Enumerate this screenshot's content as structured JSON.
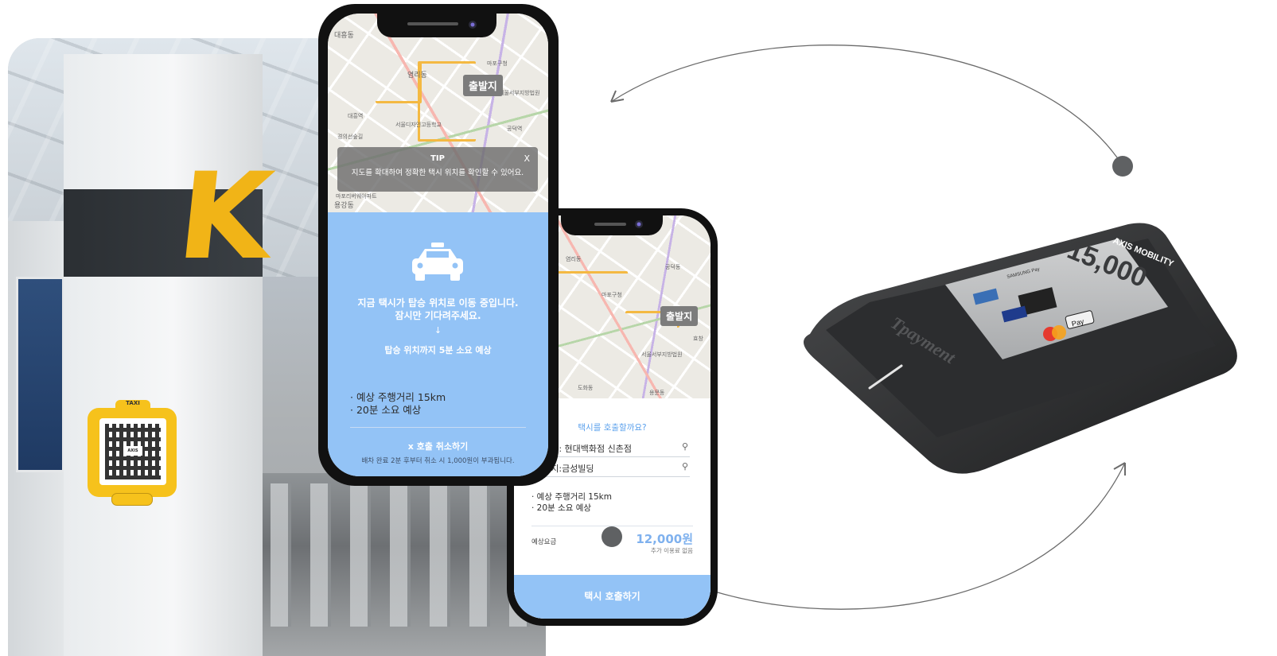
{
  "photo": {
    "pillar_letter": "K",
    "qr_sign_tab": "TAXI",
    "qr_sign_brand": "AXIS"
  },
  "phone_left": {
    "map": {
      "origin_badge": "출발지",
      "labels": [
        "대흥동",
        "염리동",
        "용강동",
        "마포구청",
        "서울서부지방법원",
        "대흥역",
        "경의선숲길",
        "서울디자인고등학교",
        "마포리버웨아파트",
        "공덕역"
      ]
    },
    "tip": {
      "title": "TIP",
      "text": "지도를 확대하여 정확한 택시 위치를 확인할 수 있어요.",
      "close": "X"
    },
    "status_line1": "지금 택시가 탑승 위치로 이동 중입니다.",
    "status_line2": "잠시만 기다려주세요.",
    "arrow": "↓",
    "eta": "탑승 위치까지 5분 소요 예상",
    "info1": "· 예상 주행거리 15km",
    "info2": "· 20분 소요 예상",
    "cancel": "x 호출 취소하기",
    "cancel_note": "배차 완료 2분 후부터 취소 시 1,000원이 부과됩니다."
  },
  "phone_right": {
    "map": {
      "origin_badge": "출발지",
      "labels": [
        "염리동",
        "공덕동",
        "마포구청",
        "서울서부지방법원",
        "도화동",
        "용문동",
        "효창"
      ]
    },
    "question": "택시를 호출할까요?",
    "departure": "출발지: 현대백화점 신촌점",
    "destination": "도착지:금성빌딩",
    "info1": "· 예상 주행거리 15km",
    "info2": "· 20분 소요 예상",
    "fare_label": "예상요금",
    "fare_value": "12,000원",
    "fare_note": "추가 이용료 없음",
    "call_button": "택시 호출하기"
  },
  "terminal": {
    "brand": "AXIS MOBILITY",
    "product": "Tpayment",
    "amount": "15,000",
    "pay_labels": [
      "SAMSUNG Pay",
      "UnionPay",
      "VISA",
      "mastercard",
      " Pay"
    ]
  },
  "colors": {
    "accent_blue": "#93c3f6",
    "fare_blue": "#7fb1ee",
    "taxi_yellow": "#f6c21c",
    "route_orange": "#f4b942"
  }
}
